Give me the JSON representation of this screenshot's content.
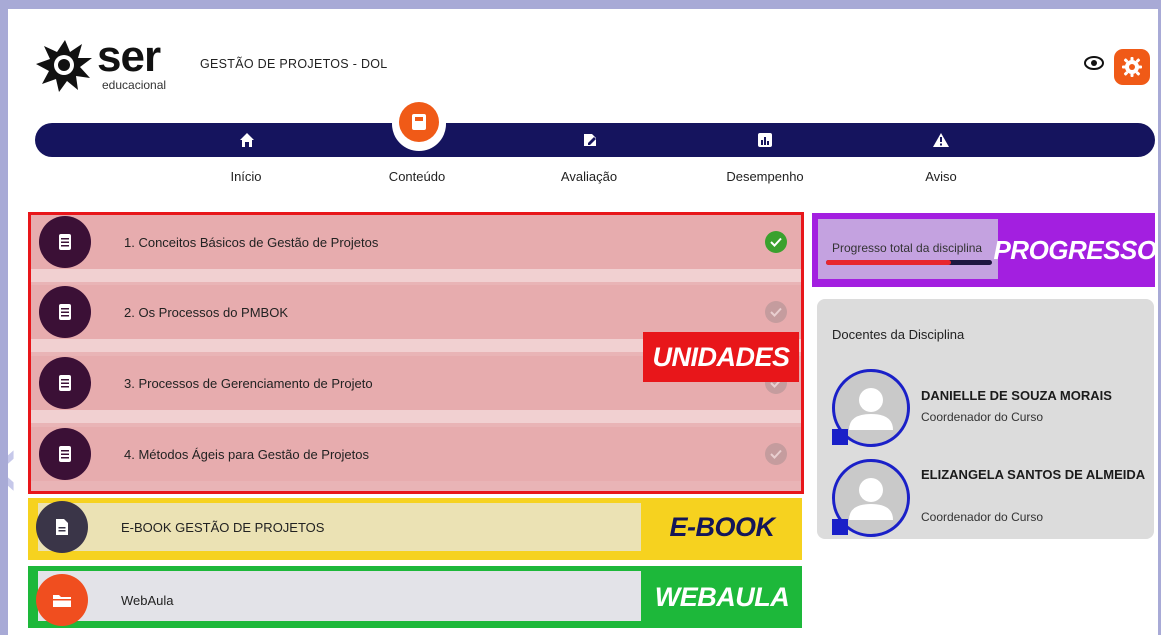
{
  "header": {
    "logo_text": "ser",
    "logo_subtext": "educacional",
    "course_title": "GESTÃO DE PROJETOS - DOL",
    "eye_icon": "eye-icon",
    "settings_icon": "gear-icon"
  },
  "nav": {
    "active": "Conteúdo",
    "items": [
      {
        "label": "Início",
        "icon": "home-icon"
      },
      {
        "label": "Conteúdo",
        "icon": "book-icon"
      },
      {
        "label": "Avaliação",
        "icon": "edit-icon"
      },
      {
        "label": "Desempenho",
        "icon": "chart-icon"
      },
      {
        "label": "Aviso",
        "icon": "warning-icon"
      }
    ]
  },
  "units": {
    "tag": "UNIDADES",
    "items": [
      {
        "label": "1. Conceitos Básicos de Gestão de Projetos",
        "completed": true
      },
      {
        "label": "2. Os Processos do PMBOK",
        "completed": false
      },
      {
        "label": "3. Processos de Gerenciamento de Projeto",
        "completed": false
      },
      {
        "label": "4. Métodos Ágeis para Gestão de Projetos",
        "completed": false
      }
    ]
  },
  "ebook": {
    "label": "E-BOOK GESTÃO DE PROJETOS",
    "tag": "E-BOOK"
  },
  "webaula": {
    "label": "WebAula",
    "tag": "WEBAULA"
  },
  "progress": {
    "label": "Progresso total da disciplina",
    "tag": "PROGRESSO",
    "value": 0.75
  },
  "docentes": {
    "title": "Docentes da Disciplina",
    "items": [
      {
        "name": "DANIELLE DE SOUZA MORAIS",
        "role": "Coordenador do Curso"
      },
      {
        "name": "ELIZANGELA SANTOS DE ALMEIDA",
        "role": "Coordenador do Curso"
      }
    ]
  },
  "colors": {
    "navy": "#15145e",
    "accent": "#f05a17",
    "units_highlight": "#e8161a",
    "ebook_highlight": "#f6d21f",
    "webaula_highlight": "#1db83a",
    "progress_highlight": "#a31fe0",
    "check_done": "#3aa12e",
    "check_pending": "#c59c9e"
  }
}
